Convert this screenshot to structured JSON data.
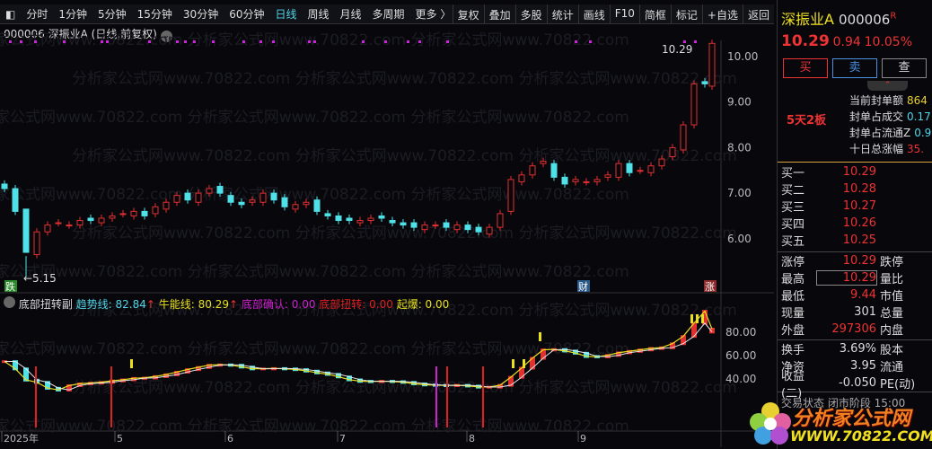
{
  "toolbar": {
    "periods": [
      "分时",
      "1分钟",
      "5分钟",
      "15分钟",
      "30分钟",
      "60分钟",
      "日线",
      "周线",
      "月线",
      "多周期",
      "更多 〉"
    ],
    "active": "日线",
    "actions": [
      "复权",
      "叠加",
      "多股",
      "统计",
      "画线",
      "F10",
      "简框",
      "标记",
      "+自选",
      "返回"
    ]
  },
  "chart": {
    "title": "000006 深振业A (日线,前复权)",
    "price_ticks": [
      "10.00",
      "9.00",
      "8.00",
      "7.00",
      "6.00"
    ],
    "low_label": "←5.15",
    "high_label": "10.29",
    "markers": [
      "跌",
      "财",
      "涨"
    ],
    "x_labels": [
      "2025年",
      "5",
      "6",
      "7",
      "8",
      "9"
    ],
    "watermark": "分析家公式网www.70822.com"
  },
  "indicator": {
    "name": "底部扭转副",
    "trend_label": "趋势线: 82.84",
    "bull_label": "牛能线: 80.29",
    "confirm_label": "底部确认: 0.00",
    "twist_label": "底部扭转: 0.00",
    "burst_label": "起爆: 0.00",
    "ticks": [
      "80.00",
      "60.00",
      "40.00"
    ],
    "colors": {
      "trend": "#4fd6e6",
      "bull": "#e8e020",
      "confirm": "#d020d0",
      "twist": "#e02020",
      "burst": "#e8e020"
    }
  },
  "chart_data": {
    "type": "candlestick",
    "closes": [
      7.1,
      6.6,
      5.7,
      6.15,
      6.3,
      6.35,
      6.3,
      6.4,
      6.4,
      6.45,
      6.5,
      6.55,
      6.6,
      6.5,
      6.7,
      6.8,
      6.95,
      6.85,
      7.0,
      7.1,
      7.0,
      6.8,
      6.75,
      6.85,
      7.0,
      6.85,
      6.7,
      6.75,
      6.8,
      6.6,
      6.5,
      6.4,
      6.4,
      6.4,
      6.45,
      6.45,
      6.35,
      6.3,
      6.25,
      6.3,
      6.3,
      6.25,
      6.3,
      6.2,
      6.15,
      6.25,
      6.55,
      7.3,
      7.4,
      7.6,
      7.7,
      7.35,
      7.2,
      7.3,
      7.25,
      7.3,
      7.4,
      7.65,
      7.45,
      7.5,
      7.6,
      7.75,
      8.0,
      8.5,
      9.4,
      9.4,
      10.29
    ],
    "ylim": [
      5.0,
      10.6
    ],
    "low": 5.15,
    "high": 10.29
  },
  "side": {
    "name": "深振业A",
    "code": "000006",
    "r": "R",
    "price": "10.29",
    "change": "0.94",
    "pct": "10.05%",
    "buy": "买",
    "sell": "卖",
    "query": "查",
    "boards": "5天2板",
    "seal": [
      {
        "l": "当前封单额",
        "v": "864"
      },
      {
        "l": "封单占成交",
        "v": "0.17"
      },
      {
        "l": "封单占流通Z",
        "v": "0.9"
      },
      {
        "l": "十日总涨幅",
        "v": "35."
      }
    ],
    "bids": [
      {
        "l": "买一",
        "v": "10.29"
      },
      {
        "l": "买二",
        "v": "10.28"
      },
      {
        "l": "买三",
        "v": "10.27"
      },
      {
        "l": "买四",
        "v": "10.26"
      },
      {
        "l": "买五",
        "v": "10.25"
      }
    ],
    "stats": [
      {
        "l": "涨停",
        "v": "10.29",
        "r": "跌停"
      },
      {
        "l": "最高",
        "v": "10.29",
        "r": "量比"
      },
      {
        "l": "最低",
        "v": "9.44",
        "r": "市值"
      },
      {
        "l": "现量",
        "v": "301",
        "r": "总量"
      },
      {
        "l": "外盘",
        "v": "297306",
        "r": "内盘"
      }
    ],
    "stats2": [
      {
        "l": "换手",
        "v": "3.69%",
        "r": "股本"
      },
      {
        "l": "净资",
        "v": "3.95",
        "r": "流通"
      },
      {
        "l": "收益(二)",
        "v": "-0.050",
        "r": "PE(动)"
      }
    ],
    "status": "交易状态 闭市阶段 15:00"
  },
  "logo": {
    "text": "分析家公式网",
    "url": "WWW.70822.COM"
  }
}
